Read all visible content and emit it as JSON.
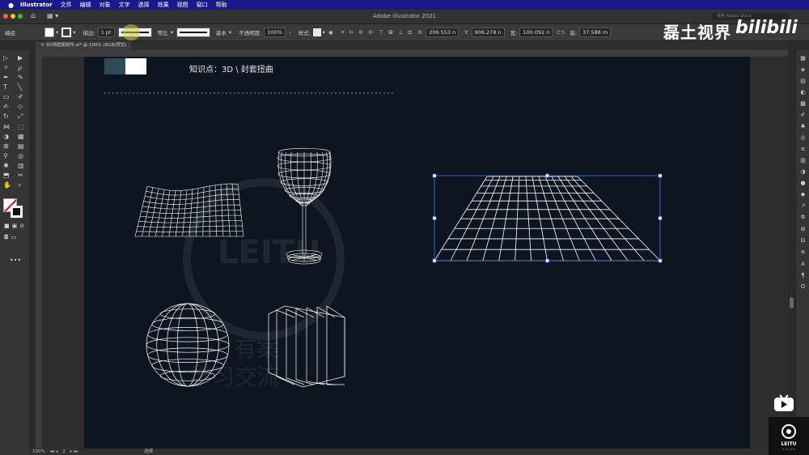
{
  "menubar": {
    "app_name": "Illustrator",
    "items": [
      "文件",
      "编辑",
      "对象",
      "文字",
      "选择",
      "效果",
      "视图",
      "窗口",
      "帮助"
    ]
  },
  "window": {
    "title": "Adobe Illustrator 2021",
    "search_placeholder": "搜索 Adobe Stock"
  },
  "control_bar": {
    "mode_label": "编组",
    "stroke_label": "描边:",
    "stroke_value": "1 pt",
    "profile_label": "等比",
    "brush_label": "基本",
    "opacity_label": "不透明度:",
    "opacity_value": "100%",
    "style_label": "样式:",
    "x_label": "X:",
    "x_value": "206.553 n",
    "y_label": "Y:",
    "y_value": "906.278 n",
    "w_label": "宽:",
    "w_value": "100.092 n",
    "h_label": "高:",
    "h_value": "37.588 m"
  },
  "tab": {
    "name": "3D线框面制作.ai* @ 100% (RGB/预览)"
  },
  "artboard": {
    "heading": "知识点：3D \\ 封套扭曲",
    "watermark_text": "LEITU",
    "watermark_text2": "有案",
    "watermark_text3": "学习交流"
  },
  "status": {
    "zoom": "100%",
    "artboard_num": "2",
    "tool": "选择"
  },
  "overlay": {
    "channel_name": "磊土视界",
    "platform": "bilibili",
    "logo_text": "LEITU",
    "logo_sub": "VISION"
  },
  "colors": {
    "artboard_bg": "#0d1620",
    "wire": "#ffffff",
    "selection": "#4a6ff0",
    "menubar_bg": "#1a1a8a"
  }
}
